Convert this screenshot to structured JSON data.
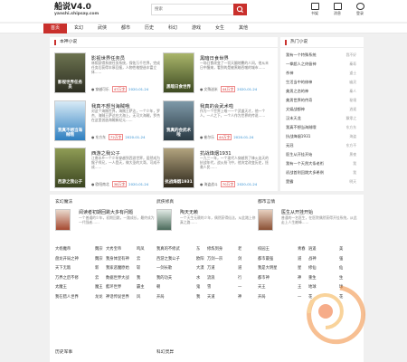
{
  "header": {
    "title": "船说V4.0",
    "subtitle": "yanshi.shipsay.com",
    "search_placeholder": "搜索",
    "icons": [
      {
        "label": "书架",
        "icon": "bookshelf-icon"
      },
      {
        "label": "消息",
        "icon": "message-icon"
      },
      {
        "label": "登录",
        "icon": "login-icon"
      }
    ]
  },
  "nav": [
    "首页",
    "玄幻",
    "武侠",
    "都市",
    "历史",
    "科幻",
    "游戏",
    "女生",
    "其他"
  ],
  "main": {
    "featured_title": "本神小说",
    "cards": [
      {
        "title": "影视世界任务员",
        "desc": "林熙获得系统任务系统，保佑万千世界，完成任务后获得丰厚回报，人物性格塑造丰富立体……",
        "author": "穿越可乐",
        "tag": "47万字",
        "date": "2020-01-24",
        "cover": "影视世界任务员",
        "color": "#3a3f2c"
      },
      {
        "title": "黑暗日食世界",
        "desc": "一场日食改变了一切天翻地覆的人间，他从末日中醒来，看到的是被黑暗吞噬的城市……",
        "author": "文殊送米",
        "tag": "44万字",
        "date": "2020-01-24",
        "cover": "黑暗日食世界",
        "color": "#5b6a35"
      },
      {
        "title": "我真不想当海贼哦",
        "desc": "对这个海贼世界，海贼王萨达，一个少年，罗杰、海贼王萨达在大海上，无可大海贼，罗杰在这里创造海贼新纪元……",
        "author": "东方东",
        "tag": "72万字",
        "date": "2020-01-24",
        "cover": "我真不想当海贼哦",
        "color": "#2d6fa8"
      },
      {
        "title": "我真的会武术啦",
        "desc": "作为一个世界上唯一一个武道天才，他一个人，一人之下，一个人作为世界的传说……",
        "author": "崔尔乐",
        "tag": "44万字",
        "date": "2020-01-24",
        "cover": "我真的会武术啦",
        "color": "#3c4e5a"
      },
      {
        "title": "西游之我公子",
        "desc": "江南水乡一个少年穿越到西游世界，居然成为猴子师兄，一人登天，做大圣的大哥，可成不成……",
        "author": "欧阳南北",
        "tag": "38万字",
        "date": "2020-01-24",
        "cover": "西游之我公子",
        "color": "#6b7a3a"
      },
      {
        "title": "抗战烽烟1931",
        "desc": "一九三一年，一个现代人穿越到了烽火连天的抗战年代，战火纷飞中，他决定改变历史，拯救人民……",
        "author": "海盗战斗",
        "tag": "70万字",
        "date": "2020-01-24",
        "cover": "抗战烽烟1931",
        "color": "#4a4030"
      }
    ]
  },
  "hot": {
    "title": "热门小说",
    "items": [
      {
        "name": "我有一个特殊系统",
        "author": "我不好"
      },
      {
        "name": "一拳超人之终极神",
        "author": "秦寿"
      },
      {
        "name": "杀神",
        "author": "道士"
      },
      {
        "name": "生活当中的修神",
        "author": "幽灵"
      },
      {
        "name": "美男之恋的神",
        "author": "秦人"
      },
      {
        "name": "美男世界的传奇",
        "author": "秘境"
      },
      {
        "name": "文娱战都神",
        "author": "逍遥"
      },
      {
        "name": "汉末天龙",
        "author": "飘零之"
      },
      {
        "name": "我真不想当海贼哦",
        "author": "东方东"
      },
      {
        "name": "抗战烽烟1931",
        "author": "海盗"
      },
      {
        "name": "无冠",
        "author": "东方不"
      },
      {
        "name": "医生从开挂开始",
        "author": "黑夜"
      },
      {
        "name": "我有一个天然大条老衔",
        "author": "我"
      },
      {
        "name": "初战首则回跳大多希例",
        "author": "我"
      },
      {
        "name": "楚霸",
        "author": "明天"
      },
      {
        "name": "生活中的幸福",
        "author": "小说"
      },
      {
        "name": "巨龙吞噬",
        "author": "暗黑"
      }
    ]
  },
  "categories": [
    {
      "name": "玄幻魔法",
      "feat_title": "阅读者初期回跳大多有问题",
      "feat_desc": "一个普通的少年，初期回跳，一路成长，最终成为一代强者……",
      "rows": [
        [
          "大杨魔帝",
          "魏宗",
          "大秀宝帝",
          "鸣凤"
        ],
        [
          "盘龙开局之神",
          "魏宗",
          "我身体里有神",
          "云"
        ],
        [
          "天下无敌",
          "新",
          "我家恶魔原始",
          "斩"
        ],
        [
          "万界之后不修",
          "云",
          "数据世界大战",
          "我"
        ],
        [
          "太魔王",
          "魔王",
          "藍环世界",
          "霸主"
        ],
        [
          "我在猎人世界",
          "龙龙",
          "神话传说世界",
          "风"
        ]
      ]
    },
    {
      "name": "武侠修真",
      "feat_title": "陶天无赖",
      "feat_desc": "一个天生无赖的少年，偶然获得仙法，从此踏上修真之路……",
      "rows": [
        [
          "我真的不修武",
          "东",
          "修炼到身",
          "老"
        ],
        [
          "西游之我公子",
          "欧阳",
          "万剑一宗",
          "剑"
        ],
        [
          "一剑长歌",
          "大漠",
          "万道",
          "道"
        ],
        [
          "我的功夫",
          "水",
          "流浪",
          "行"
        ],
        [
          "朝",
          "鬼",
          "雪",
          "一"
        ],
        [
          "开局",
          "我",
          "天道",
          "神"
        ]
      ]
    },
    {
      "name": "都市言情",
      "feat_title": "医生从开挂开始",
      "feat_desc": "普通的一名医生，在医院偶然获得开挂系统，从此走上人生巅峰……",
      "rows": [
        [
          "校园王",
          "青春",
          "逍遥",
          "美"
        ],
        [
          "都市最强",
          "道",
          "战神",
          "强"
        ],
        [
          "我是大明星",
          "星",
          "修仙",
          "仙"
        ],
        [
          "都市神",
          "神",
          "重生",
          "生"
        ],
        [
          "天王",
          "王",
          "地球",
          "球"
        ],
        [
          "开局",
          "一",
          "花",
          "花"
        ]
      ]
    }
  ],
  "sections": [
    "历史军事",
    "科幻灵异"
  ]
}
